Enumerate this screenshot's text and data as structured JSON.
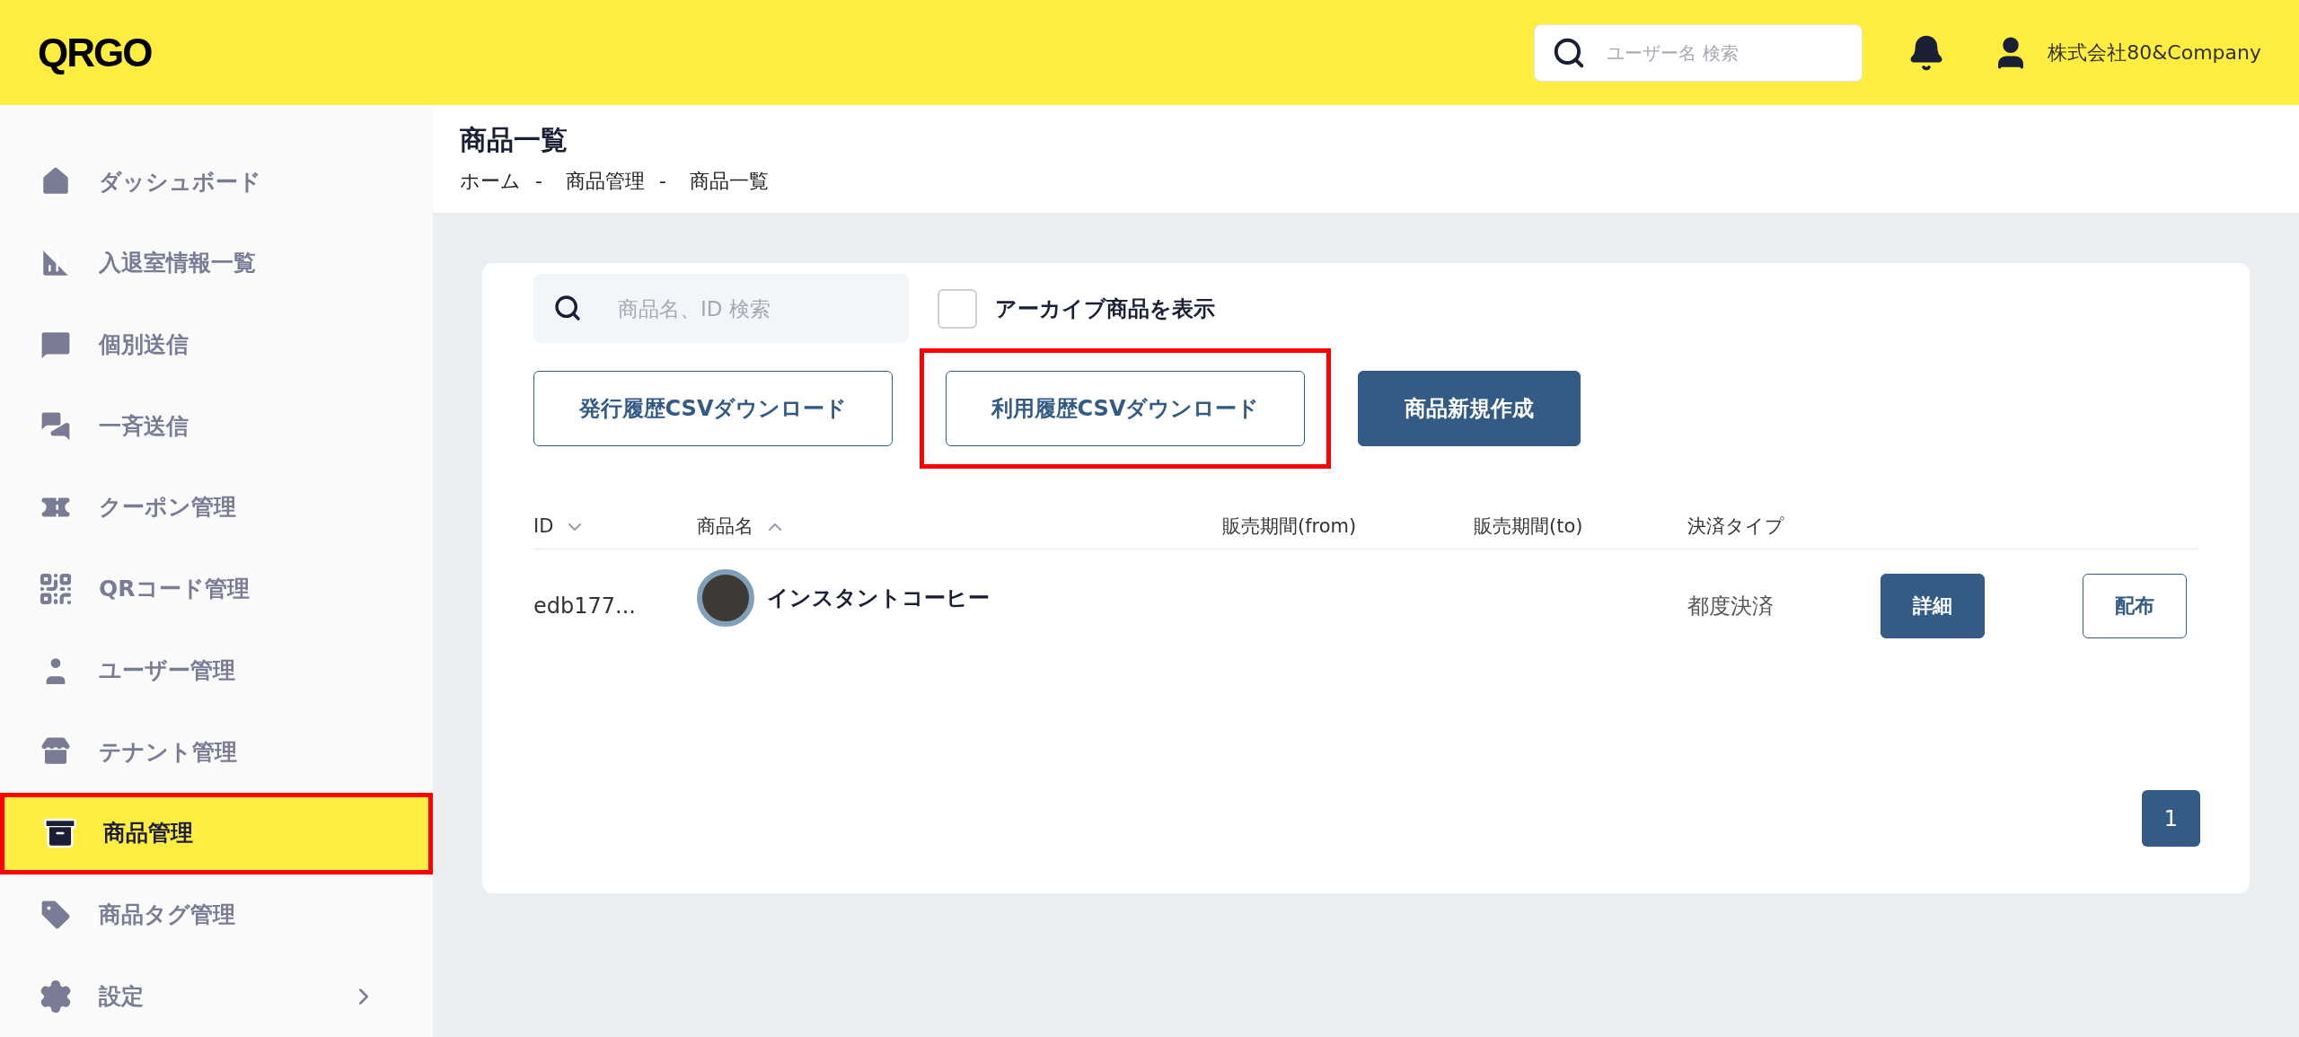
{
  "header": {
    "logo": "QRGO",
    "search": {
      "placeholder": "ユーザー名 検索"
    },
    "account": "株式会社80&Company"
  },
  "sidebar": {
    "items": [
      {
        "label": "ダッシュボード",
        "selected": false,
        "annotated": false,
        "has_submenu": false
      },
      {
        "label": "入退室情報一覧",
        "selected": false,
        "annotated": false,
        "has_submenu": false
      },
      {
        "label": "個別送信",
        "selected": false,
        "annotated": false,
        "has_submenu": false
      },
      {
        "label": "一斉送信",
        "selected": false,
        "annotated": false,
        "has_submenu": false
      },
      {
        "label": "クーポン管理",
        "selected": false,
        "annotated": false,
        "has_submenu": false
      },
      {
        "label": "QRコード管理",
        "selected": false,
        "annotated": false,
        "has_submenu": false
      },
      {
        "label": "ユーザー管理",
        "selected": false,
        "annotated": false,
        "has_submenu": false
      },
      {
        "label": "テナント管理",
        "selected": false,
        "annotated": false,
        "has_submenu": false
      },
      {
        "label": "商品管理",
        "selected": true,
        "annotated": true,
        "has_submenu": false
      },
      {
        "label": "商品タグ管理",
        "selected": false,
        "annotated": false,
        "has_submenu": false
      },
      {
        "label": "設定",
        "selected": false,
        "annotated": false,
        "has_submenu": true
      }
    ]
  },
  "page": {
    "title": "商品一覧",
    "breadcrumb": [
      "ホーム",
      "商品管理",
      "商品一覧"
    ],
    "breadcrumb_separator": "-"
  },
  "toolbar": {
    "search": {
      "placeholder": "商品名、ID 検索"
    },
    "archive_checkbox": {
      "label": "アーカイブ商品を表示",
      "checked": false
    },
    "buttons": [
      {
        "label": "発行履歴CSVダウンロード",
        "kind": "outline",
        "annotated": false
      },
      {
        "label": "利用履歴CSVダウンロード",
        "kind": "outline",
        "annotated": true
      },
      {
        "label": "商品新規作成",
        "kind": "primary",
        "annotated": false
      }
    ]
  },
  "table": {
    "columns": [
      {
        "label": "ID",
        "sort_down": true,
        "sort_up": false
      },
      {
        "label": "商品名",
        "sort_down": false,
        "sort_up": true
      },
      {
        "label": "販売期間(from)",
        "sort_down": false,
        "sort_up": false
      },
      {
        "label": "販売期間(to)",
        "sort_down": false,
        "sort_up": false
      },
      {
        "label": "決済タイプ",
        "sort_down": false,
        "sort_up": false
      }
    ],
    "rows": [
      {
        "id": "edb177...",
        "name": "インスタントコーヒー",
        "from": "",
        "to": "",
        "payment_type": "都度決済",
        "actions": [
          {
            "label": "詳細",
            "kind": "primary"
          },
          {
            "label": "配布",
            "kind": "outline"
          }
        ]
      }
    ]
  },
  "pagination": [
    {
      "label": "1",
      "selected": true
    }
  ]
}
